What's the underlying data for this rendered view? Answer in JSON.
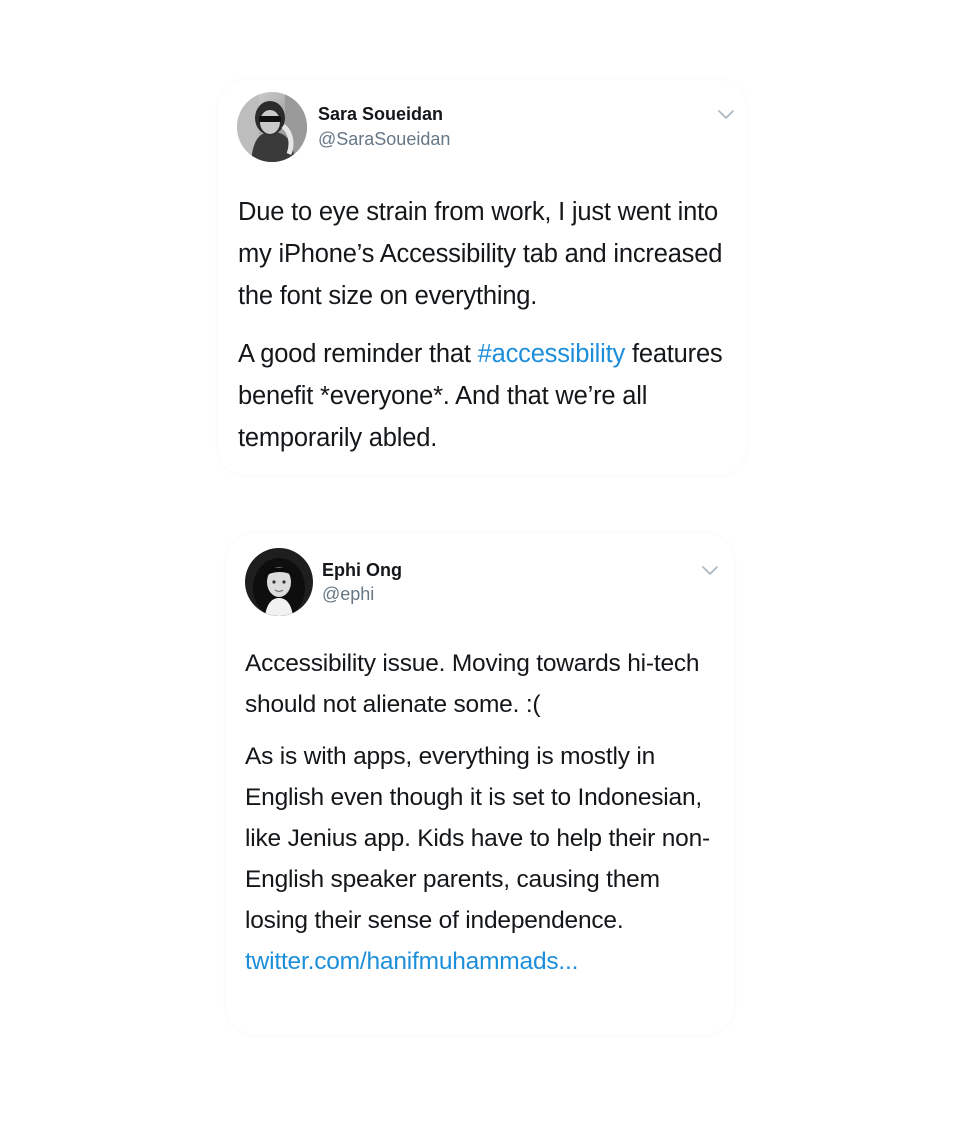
{
  "tweets": [
    {
      "author_name": "Sara Soueidan",
      "author_handle": "@SaraSoueidan",
      "paragraphs": [
        {
          "text": "Due to eye strain from work, I just went into my iPhone’s Accessibility tab and increased the font size on everything."
        },
        {
          "before": "A good reminder that ",
          "hashtag": "#accessibility",
          "after": " features benefit *everyone*. And that we’re all temporarily abled."
        }
      ]
    },
    {
      "author_name": "Ephi Ong",
      "author_handle": "@ephi",
      "paragraphs": [
        {
          "text": "Accessibility issue. Moving towards hi-tech should not alienate some. :("
        },
        {
          "before": "As is with apps, everything is mostly in English even though it is set to Indonesian, like Jenius app. Kids have to help their non-English speaker parents, causing them losing their sense of independence. ",
          "link": "twitter.com/hanifmuhammads..."
        }
      ]
    }
  ],
  "colors": {
    "text": "#14171a",
    "secondary": "#657786",
    "link": "#1d8fda",
    "chevron": "#aab8c2"
  },
  "icons": {
    "menu": "chevron-down-icon"
  }
}
